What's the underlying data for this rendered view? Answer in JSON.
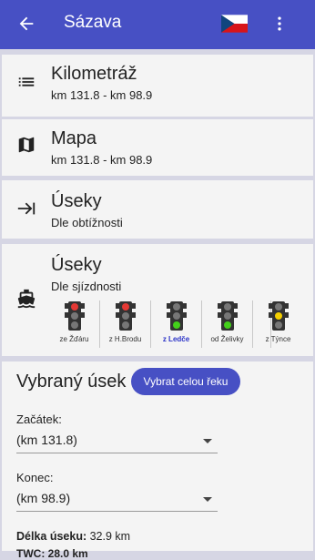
{
  "appbar": {
    "title": "Sázava",
    "flag": "cz-flag",
    "back_icon": "arrow-back-icon",
    "more_icon": "more-vert-icon"
  },
  "cards": [
    {
      "title": "Kilometráž",
      "subtitle": "km 131.8 - km 98.9",
      "icon": "list-icon"
    },
    {
      "title": "Mapa",
      "subtitle": "km 131.8 - km 98.9",
      "icon": "map-icon"
    },
    {
      "title": "Úseky",
      "subtitle": "Dle obtížnosti",
      "icon": "arrow-to-end-icon"
    },
    {
      "title": "Úseky",
      "subtitle": "Dle sjízdnosti",
      "icon": "boat-icon"
    }
  ],
  "traffic_lights": [
    {
      "label": "ze Žďáru",
      "state": "red",
      "active": false
    },
    {
      "label": "z H.Brodu",
      "state": "red",
      "active": false
    },
    {
      "label": "z Ledče",
      "state": "green",
      "active": true
    },
    {
      "label": "od Želivky",
      "state": "green",
      "active": false
    },
    {
      "label": "z Týnce",
      "state": "yellow",
      "active": false
    }
  ],
  "section": {
    "heading": "Vybraný úsek",
    "select_all_button": "Vybrat celou řeku",
    "start_label": "Začátek:",
    "start_value": "(km 131.8)",
    "end_label": "Konec:",
    "end_value": "(km 98.9)",
    "length_label": "Délka úseku:",
    "length_value": "32.9 km",
    "cut_text": "TWC: 28.0 km"
  },
  "colors": {
    "primary": "#4750c4",
    "background": "#d6d6e4",
    "card": "#f4f4f4"
  }
}
